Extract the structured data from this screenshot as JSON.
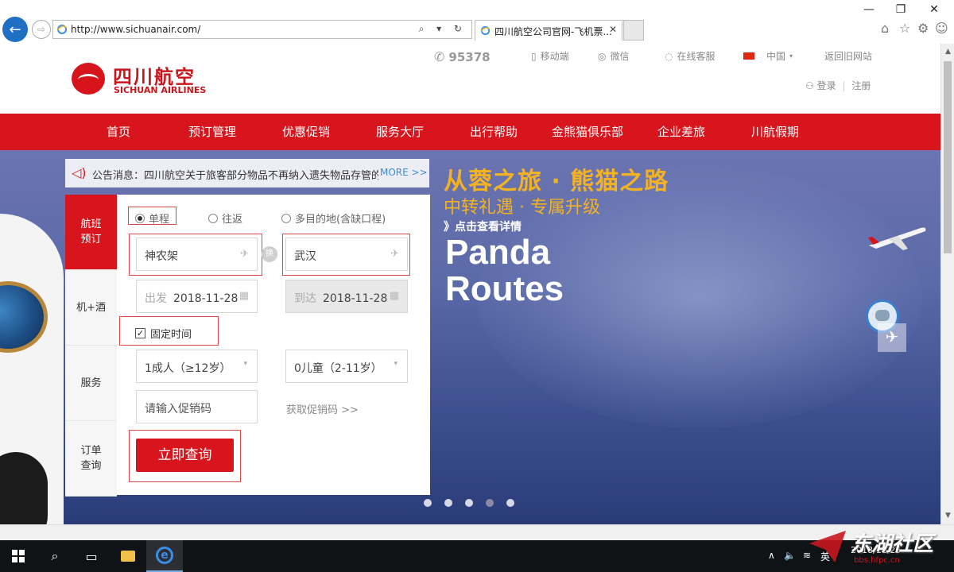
{
  "browser": {
    "url": "http://www.sichuanair.com/",
    "tab_title": "四川航空公司官网-飞机票...",
    "address_tools": "⌕ ▾ ↻"
  },
  "header": {
    "logo_cn": "四川航空",
    "logo_en": "SICHUAN AIRLINES",
    "hotline": "95378",
    "mobile": "移动端",
    "wechat": "微信",
    "online_service": "在线客服",
    "region": "中国",
    "old_site": "返回旧网站",
    "login": "登录",
    "separator": "|",
    "register": "注册"
  },
  "nav": [
    "首页",
    "预订管理",
    "优惠促销",
    "服务大厅",
    "出行帮助",
    "金熊猫俱乐部",
    "企业差旅",
    "川航假期"
  ],
  "notice": {
    "text": "公告消息：四川航空关于旅客部分物品不再纳入遗失物品存管的",
    "more": "MORE >>"
  },
  "booking": {
    "side_tabs": [
      "航班\n预订",
      "机+酒",
      "服务",
      "订单\n查询"
    ],
    "trip_types": [
      "单程",
      "往返",
      "多目的地(含缺口程)"
    ],
    "selected_trip": "单程",
    "from": "神农架",
    "to": "武汉",
    "swap_label": "换",
    "depart_label": "出发",
    "depart_date": "2018-11-28",
    "arrive_label": "到达",
    "arrive_date": "2018-11-28",
    "fixed_time": "固定时间",
    "adults": "1成人（≥12岁）",
    "children": "0儿童（2-11岁）",
    "promo_placeholder": "请输入促销码",
    "get_promo": "获取促销码 >>",
    "search_button": "立即查询"
  },
  "banner": {
    "title_line1": "Panda",
    "title_line2": "Routes",
    "subtitle": "从蓉之旅 · 熊猫之路",
    "tagline": "中转礼遇 · 专属升级",
    "link": "》点击查看详情",
    "slides": 5,
    "active_slide": 4
  },
  "taskbar": {
    "ime": "英",
    "clock_time": "",
    "clock_date": "2018/11/25"
  },
  "watermark": {
    "cn": "东湖社区",
    "url": "bbs.hfpc.cn"
  },
  "colors": {
    "brand_red": "#d8141c",
    "banner_blue": "#4a5a9a",
    "promo_yellow": "#f3b224"
  }
}
